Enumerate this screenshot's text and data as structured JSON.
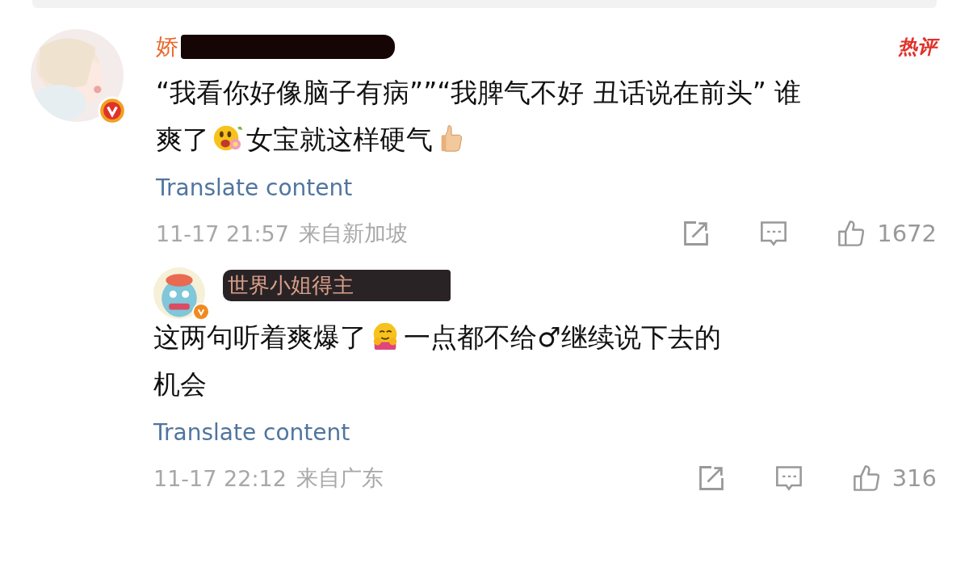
{
  "comments": [
    {
      "username": "娇",
      "hot_tag": "热评",
      "verified": true,
      "body_lines": [
        [
          {
            "kind": "text",
            "text": "“我看你好像脑子有病””“我脾气不好 丑话说在前头” 谁"
          }
        ],
        [
          {
            "kind": "text",
            "text": "爽了"
          },
          {
            "kind": "laugh"
          },
          {
            "kind": "text",
            "text": "女宝就这样硬气"
          },
          {
            "kind": "thumb"
          }
        ]
      ],
      "translate": "Translate content",
      "time": "11-17 21:57",
      "location": "来自新加坡",
      "likes": "1672",
      "replies": [
        {
          "username": "世界小姐得主",
          "verified": true,
          "body_lines": [
            [
              {
                "kind": "text",
                "text": "这两句听着爽爆了"
              },
              {
                "kind": "hug"
              },
              {
                "kind": "text",
                "text": "一点都不给♂继续说下去的"
              }
            ],
            [
              {
                "kind": "text",
                "text": "机会"
              }
            ]
          ],
          "translate": "Translate content",
          "time": "11-17 22:12",
          "location": "来自广东",
          "likes": "316"
        }
      ]
    }
  ]
}
